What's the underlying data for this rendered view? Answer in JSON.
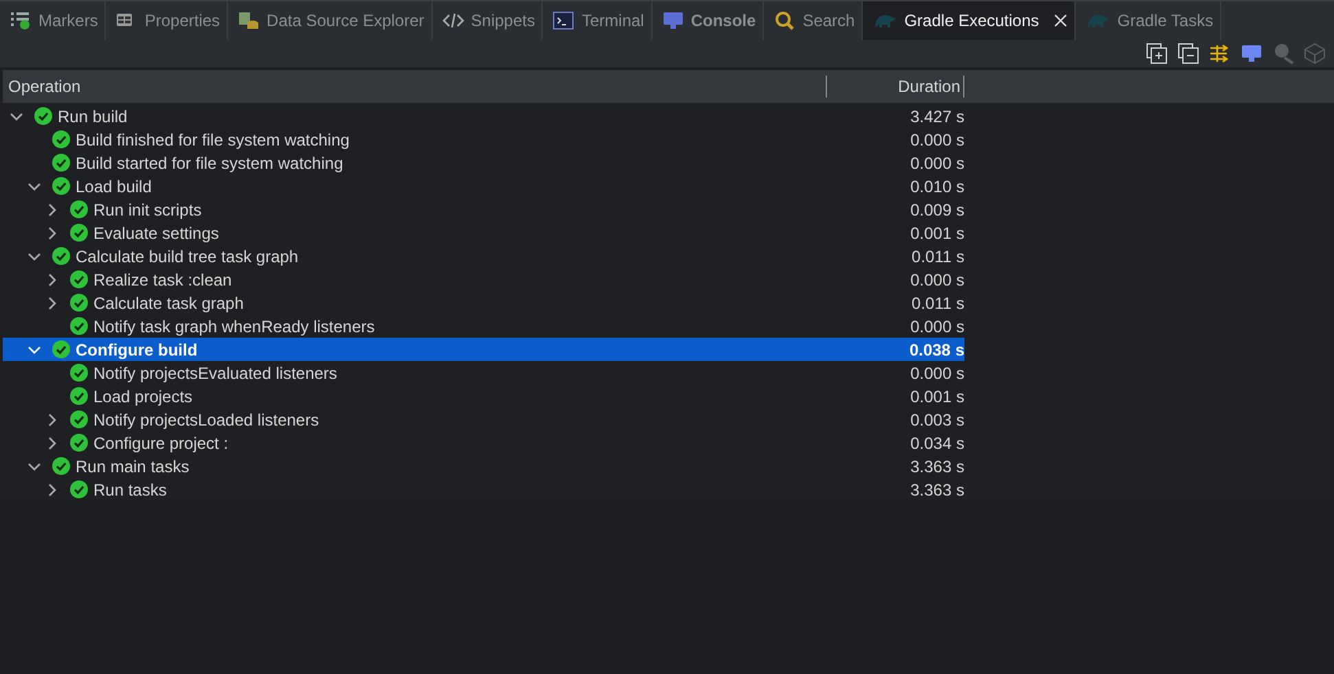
{
  "tabs": [
    {
      "kind": "markers",
      "label": "Markers",
      "selected": false,
      "bold": false
    },
    {
      "kind": "properties",
      "label": "Properties",
      "selected": false,
      "bold": false
    },
    {
      "kind": "datasource",
      "label": "Data Source Explorer",
      "selected": false,
      "bold": false
    },
    {
      "kind": "snippets",
      "label": "Snippets",
      "selected": false,
      "bold": false
    },
    {
      "kind": "terminal",
      "label": "Terminal",
      "selected": false,
      "bold": false
    },
    {
      "kind": "console",
      "label": "Console",
      "selected": false,
      "bold": true
    },
    {
      "kind": "search",
      "label": "Search",
      "selected": false,
      "bold": false
    },
    {
      "kind": "gradle",
      "label": "Gradle Executions",
      "selected": true,
      "bold": false
    },
    {
      "kind": "gradle",
      "label": "Gradle Tasks",
      "selected": false,
      "bold": false
    }
  ],
  "toolbar": [
    {
      "kind": "expand-all",
      "disabled": false
    },
    {
      "kind": "collapse-all",
      "disabled": false
    },
    {
      "kind": "filter",
      "disabled": false
    },
    {
      "kind": "console",
      "disabled": false
    },
    {
      "kind": "remove",
      "disabled": true
    },
    {
      "kind": "clear",
      "disabled": true
    }
  ],
  "table": {
    "columns": [
      "Operation",
      "Duration"
    ],
    "rows": [
      {
        "operation": "Run build",
        "duration": "3.427 s",
        "selected": false,
        "expanded": true,
        "children": [
          {
            "operation": "Build finished for file system watching",
            "duration": "0.000 s",
            "selected": false
          },
          {
            "operation": "Build started for file system watching",
            "duration": "0.000 s",
            "selected": false
          },
          {
            "operation": "Load build",
            "duration": "0.010 s",
            "selected": false,
            "expanded": true,
            "children": [
              {
                "operation": "Run init scripts",
                "duration": "0.009 s",
                "selected": false,
                "expanded": false
              },
              {
                "operation": "Evaluate settings",
                "duration": "0.001 s",
                "selected": false,
                "expanded": false
              }
            ]
          },
          {
            "operation": "Calculate build tree task graph",
            "duration": "0.011 s",
            "selected": false,
            "expanded": true,
            "children": [
              {
                "operation": "Realize task :clean",
                "duration": "0.000 s",
                "selected": false,
                "expanded": false
              },
              {
                "operation": "Calculate task graph",
                "duration": "0.011 s",
                "selected": false,
                "expanded": false
              },
              {
                "operation": "Notify task graph whenReady listeners",
                "duration": "0.000 s",
                "selected": false
              }
            ]
          },
          {
            "operation": "Configure build",
            "duration": "0.038 s",
            "selected": true,
            "expanded": true,
            "children": [
              {
                "operation": "Notify projectsEvaluated listeners",
                "duration": "0.000 s",
                "selected": false
              },
              {
                "operation": "Load projects",
                "duration": "0.001 s",
                "selected": false
              },
              {
                "operation": "Notify projectsLoaded listeners",
                "duration": "0.003 s",
                "selected": false,
                "expanded": false
              },
              {
                "operation": "Configure project :",
                "duration": "0.034 s",
                "selected": false,
                "expanded": false
              }
            ]
          },
          {
            "operation": "Run main tasks",
            "duration": "3.363 s",
            "selected": false,
            "expanded": true,
            "children": [
              {
                "operation": "Run tasks",
                "duration": "3.363 s",
                "selected": false,
                "expanded": false
              }
            ]
          }
        ]
      }
    ]
  }
}
